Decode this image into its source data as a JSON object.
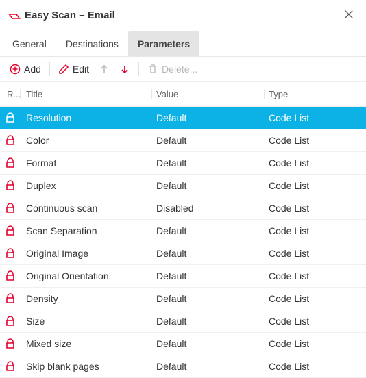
{
  "window": {
    "title": "Easy Scan – Email",
    "close_label": "✕"
  },
  "tabs": [
    {
      "label": "General",
      "selected": false
    },
    {
      "label": "Destinations",
      "selected": false
    },
    {
      "label": "Parameters",
      "selected": true
    }
  ],
  "toolbar": {
    "add": "Add",
    "edit": "Edit",
    "delete": "Delete..."
  },
  "columns": {
    "r": "R...",
    "title": "Title",
    "value": "Value",
    "type": "Type"
  },
  "rows": [
    {
      "title": "Resolution",
      "value": "Default",
      "type": "Code List",
      "selected": true
    },
    {
      "title": "Color",
      "value": "Default",
      "type": "Code List",
      "selected": false
    },
    {
      "title": "Format",
      "value": "Default",
      "type": "Code List",
      "selected": false
    },
    {
      "title": "Duplex",
      "value": "Default",
      "type": "Code List",
      "selected": false
    },
    {
      "title": "Continuous scan",
      "value": "Disabled",
      "type": "Code List",
      "selected": false
    },
    {
      "title": "Scan Separation",
      "value": "Default",
      "type": "Code List",
      "selected": false
    },
    {
      "title": "Original Image",
      "value": "Default",
      "type": "Code List",
      "selected": false
    },
    {
      "title": "Original Orientation",
      "value": "Default",
      "type": "Code List",
      "selected": false
    },
    {
      "title": "Density",
      "value": "Default",
      "type": "Code List",
      "selected": false
    },
    {
      "title": "Size",
      "value": "Default",
      "type": "Code List",
      "selected": false
    },
    {
      "title": "Mixed size",
      "value": "Default",
      "type": "Code List",
      "selected": false
    },
    {
      "title": "Skip blank pages",
      "value": "Default",
      "type": "Code List",
      "selected": false
    }
  ]
}
